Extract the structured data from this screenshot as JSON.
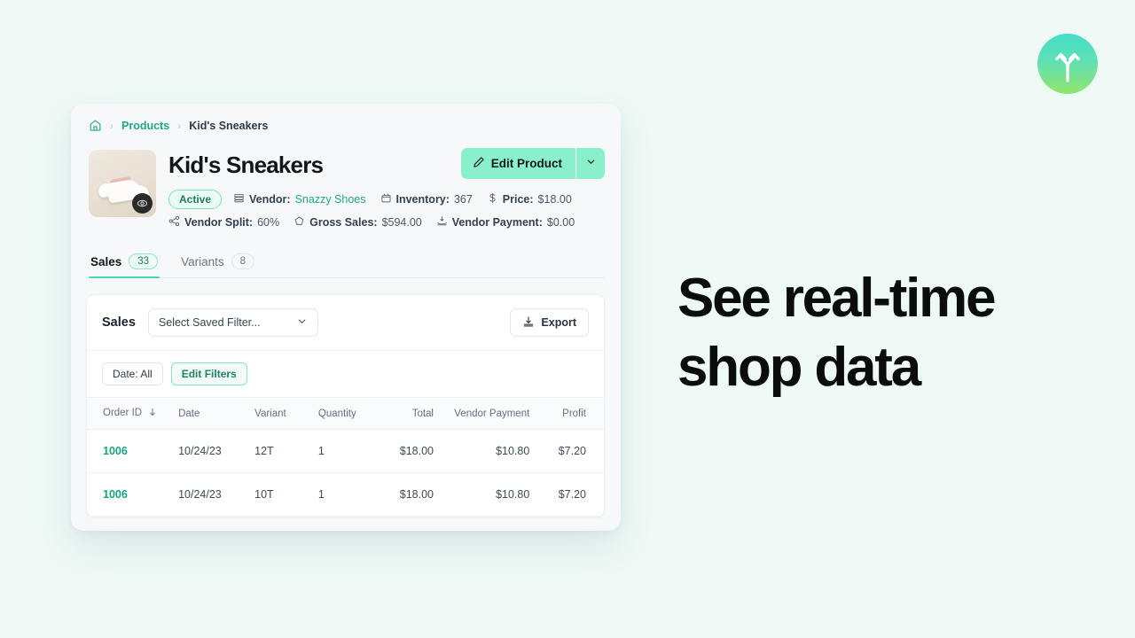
{
  "logo": {
    "icon": "forked-up-arrows-icon",
    "gradient_from": "#44dcc8",
    "gradient_to": "#92e56c"
  },
  "marketing": {
    "line1": "See real-time",
    "line2": "shop data"
  },
  "colors": {
    "page_background": "#effaf6",
    "accent_mint": "#8aefcb",
    "accent_teal": "#1fa984",
    "tab_underline": "#45dcb3",
    "link_green": "#17a37d"
  },
  "breadcrumb": {
    "home_icon": "home-icon",
    "separator": "›",
    "products": "Products",
    "current": "Kid's Sneakers"
  },
  "product": {
    "title": "Kid's Sneakers",
    "thumbnail_alt": "Kid's Sneakers product photo",
    "status_badge": "Active",
    "meta_row1": [
      {
        "icon": "vendor-icon",
        "label": "Vendor:",
        "value": "Snazzy Shoes",
        "link": true
      },
      {
        "icon": "inventory-box-icon",
        "label": "Inventory:",
        "value": "367",
        "link": false
      },
      {
        "icon": "dollar-icon",
        "label": "Price:",
        "value": "$18.00",
        "link": false
      }
    ],
    "meta_row2": [
      {
        "icon": "split-share-icon",
        "label": "Vendor Split:",
        "value": "60%",
        "link": false
      },
      {
        "icon": "gross-sales-icon",
        "label": "Gross Sales:",
        "value": "$594.00",
        "link": false
      },
      {
        "icon": "vendor-payment-icon",
        "label": "Vendor Payment:",
        "value": "$0.00",
        "link": false
      }
    ],
    "edit_button": {
      "label": "Edit Product",
      "icon": "pencil-icon",
      "caret_icon": "chevron-down-icon"
    }
  },
  "tabs": [
    {
      "label": "Sales",
      "count": "33",
      "active": true
    },
    {
      "label": "Variants",
      "count": "8",
      "active": false
    }
  ],
  "panel": {
    "title": "Sales",
    "saved_filter_value": "Select Saved Filter...",
    "saved_filter_caret": "chevron-down-icon",
    "export_label": "Export",
    "export_icon": "download-icon",
    "filters": [
      {
        "label": "Date: All",
        "accent": false
      },
      {
        "label": "Edit Filters",
        "accent": true
      }
    ]
  },
  "table": {
    "columns": [
      {
        "label": "Order ID",
        "sorted": true,
        "sort_icon": "arrow-down-icon"
      },
      {
        "label": "Date",
        "sorted": false
      },
      {
        "label": "Variant",
        "sorted": false
      },
      {
        "label": "Quantity",
        "sorted": false
      },
      {
        "label": "Total",
        "sorted": false
      },
      {
        "label": "Vendor Payment",
        "sorted": false
      },
      {
        "label": "Profit",
        "sorted": false
      }
    ],
    "rows": [
      {
        "order_id": "1006",
        "date": "10/24/23",
        "variant": "12T",
        "quantity": "1",
        "total": "$18.00",
        "vendor_payment": "$10.80",
        "profit": "$7.20"
      },
      {
        "order_id": "1006",
        "date": "10/24/23",
        "variant": "10T",
        "quantity": "1",
        "total": "$18.00",
        "vendor_payment": "$10.80",
        "profit": "$7.20"
      }
    ]
  }
}
